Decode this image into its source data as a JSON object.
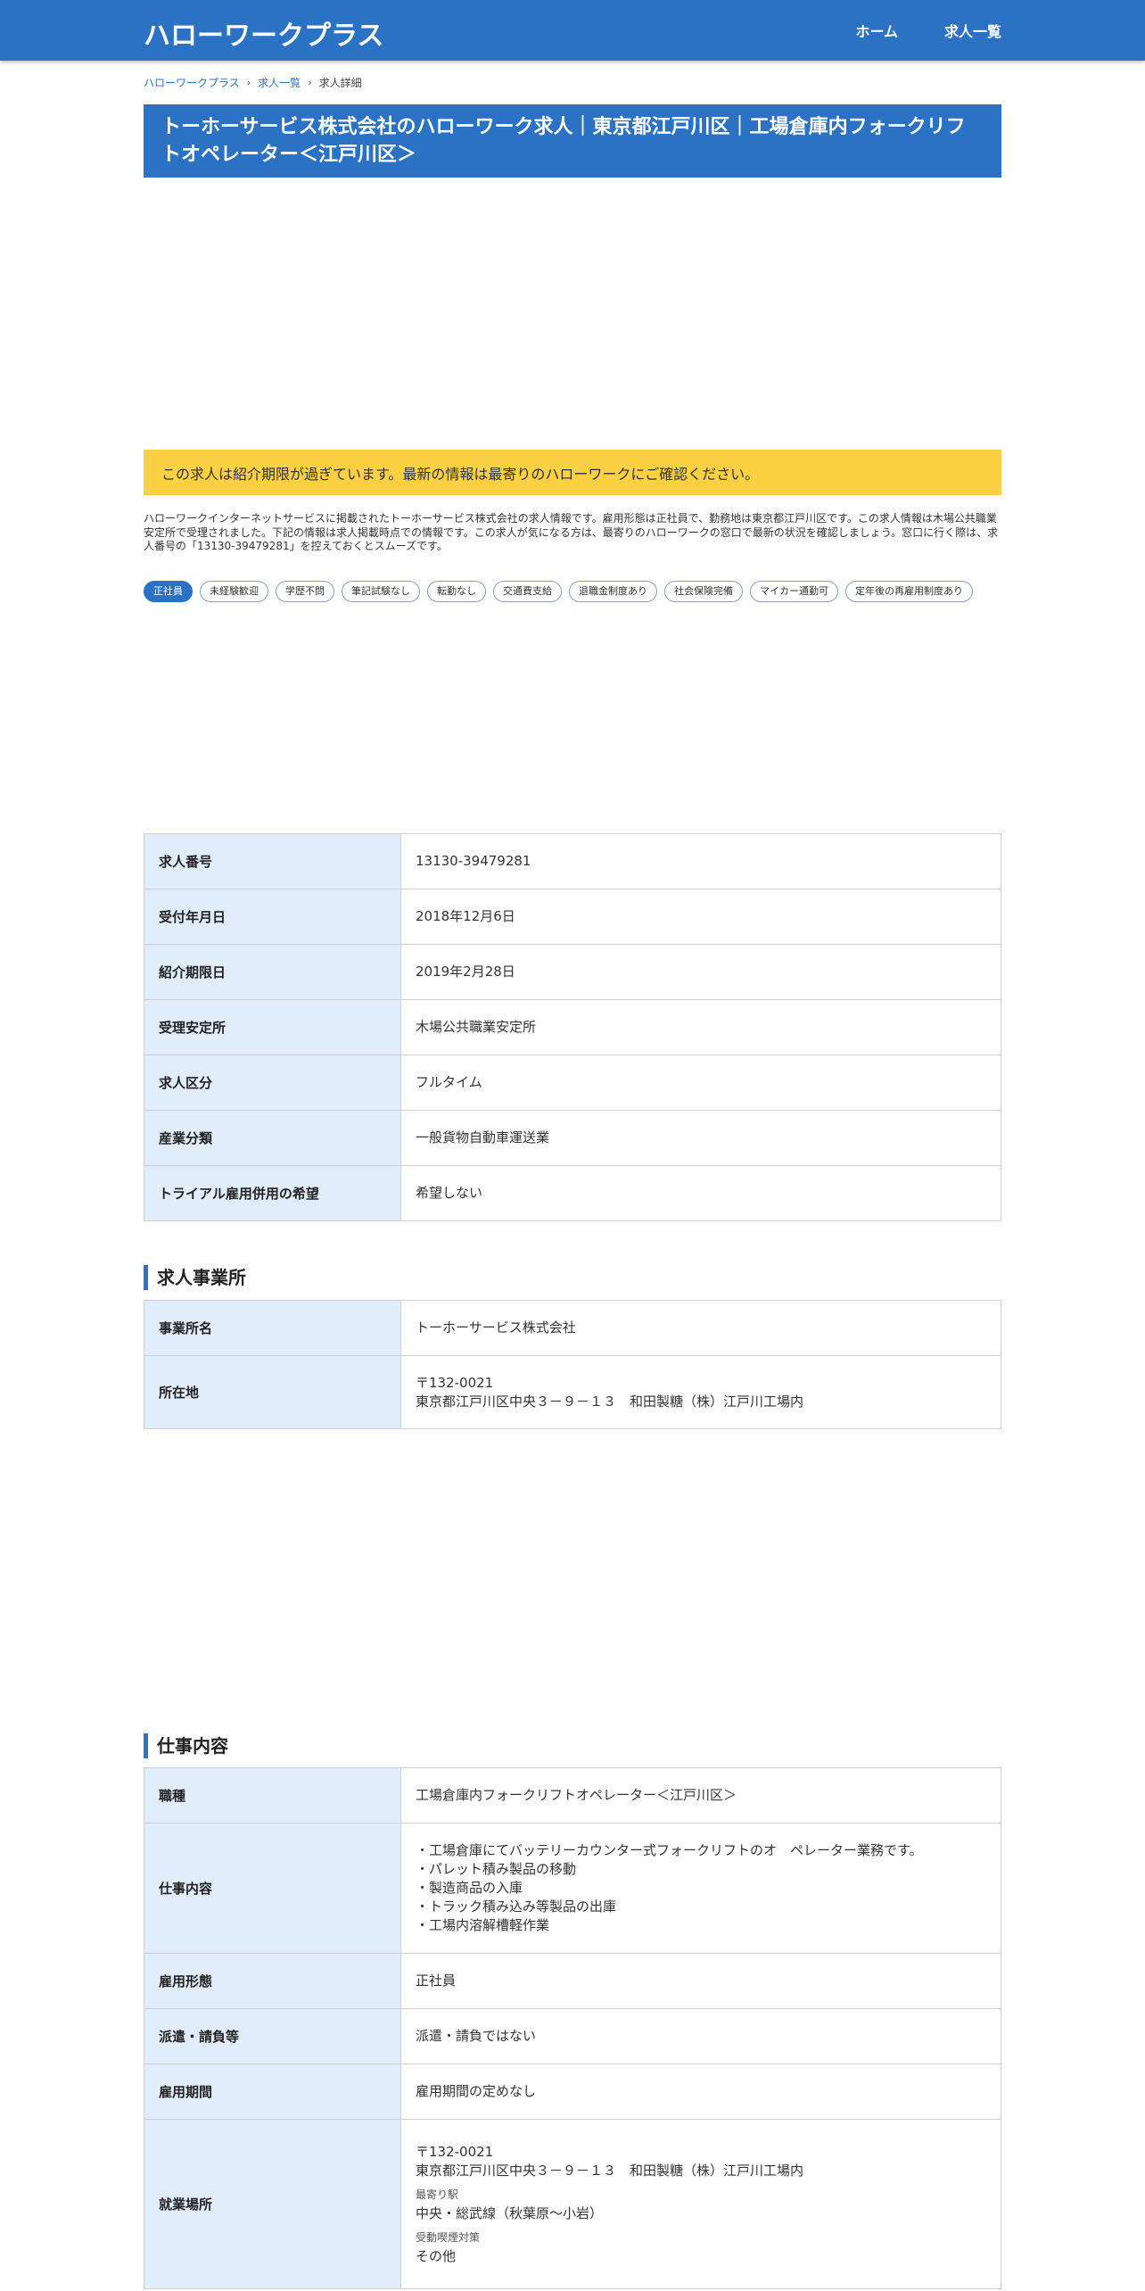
{
  "header": {
    "brand": "ハローワークプラス",
    "nav": [
      "ホーム",
      "求人一覧"
    ]
  },
  "breadcrumb": {
    "items": [
      "ハローワークプラス",
      "求人一覧"
    ],
    "current": "求人詳細"
  },
  "title": "トーホーサービス株式会社のハローワーク求人｜東京都江戸川区｜工場倉庫内フォークリフトオペレーター＜江戸川区＞",
  "notice": "この求人は紹介期限が過ぎています。最新の情報は最寄りのハローワークにご確認ください。",
  "intro": "ハローワークインターネットサービスに掲載されたトーホーサービス株式会社の求人情報です。雇用形態は正社員で、勤務地は東京都江戸川区です。この求人情報は木場公共職業安定所で受理されました。下記の情報は求人掲載時点での情報です。この求人が気になる方は、最寄りのハローワークの窓口で最新の状況を確認しましょう。窓口に行く際は、求人番号の「13130-39479281」を控えておくとスムーズです。",
  "tags": [
    "正社員",
    "未経験歓迎",
    "学歴不問",
    "筆記試験なし",
    "転勤なし",
    "交通費支給",
    "退職金制度あり",
    "社会保険完備",
    "マイカー通勤可",
    "定年後の再雇用制度あり"
  ],
  "basic_info": [
    {
      "label": "求人番号",
      "value": "13130-39479281"
    },
    {
      "label": "受付年月日",
      "value": "2018年12月6日"
    },
    {
      "label": "紹介期限日",
      "value": "2019年2月28日"
    },
    {
      "label": "受理安定所",
      "value": "木場公共職業安定所"
    },
    {
      "label": "求人区分",
      "value": "フルタイム"
    },
    {
      "label": "産業分類",
      "value": "一般貨物自動車運送業"
    },
    {
      "label": "トライアル雇用併用の希望",
      "value": "希望しない"
    }
  ],
  "office": {
    "section_title": "求人事業所",
    "name_label": "事業所名",
    "name": "トーホーサービス株式会社",
    "address_label": "所在地",
    "postal": "〒132-0021",
    "address": "東京都江戸川区中央３－９－１３　和田製糖（株）江戸川工場内"
  },
  "job": {
    "section_title": "仕事内容",
    "type_label": "職種",
    "type": "工場倉庫内フォークリフトオペレーター＜江戸川区＞",
    "content_label": "仕事内容",
    "content_lines": [
      "・工場倉庫にてバッテリーカウンター式フォークリフトのオ　ペレーター業務です。",
      "・パレット積み製品の移動",
      "・製造商品の入庫",
      "・トラック積み込み等製品の出庫",
      "・工場内溶解槽軽作業"
    ],
    "employment_label": "雇用形態",
    "employment": "正社員",
    "dispatch_label": "派遣・請負等",
    "dispatch": "派遣・請負ではない",
    "period_label": "雇用期間",
    "period": "雇用期間の定めなし",
    "workplace_label": "就業場所",
    "workplace_postal": "〒132-0021",
    "workplace_address": "東京都江戸川区中央３－９－１３　和田製糖（株）江戸川工場内",
    "station_label": "最寄り駅",
    "station": "中央・総武線（秋葉原～小岩）",
    "smoking_label": "受動喫煙対策",
    "smoking": "その他"
  }
}
